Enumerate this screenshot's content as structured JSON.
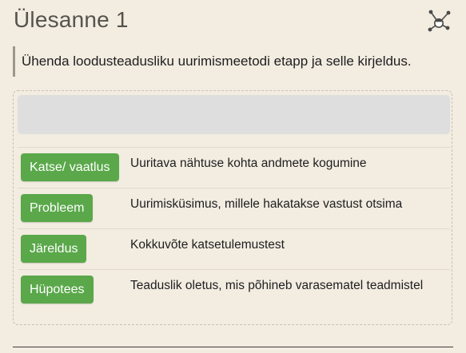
{
  "header": {
    "title": "Ülesanne 1",
    "icon": "network-icon"
  },
  "instruction": "Ühenda loodusteadusliku uurimismeetodi etapp ja selle kirjeldus.",
  "colors": {
    "chip": "#5aa84a",
    "background": "#f2ece1",
    "drop_area": "#dedede"
  },
  "rows": [
    {
      "term": "Katse/ vaatlus",
      "description": "Uuritava nähtuse kohta andmete kogumine"
    },
    {
      "term": "Probleem",
      "description": "Uurimisküsimus, millele hakatakse vastust otsima"
    },
    {
      "term": "Järeldus",
      "description": "Kokkuvõte katsetulemustest"
    },
    {
      "term": "Hüpotees",
      "description": "Teaduslik oletus, mis põhineb varasematel teadmistel"
    }
  ]
}
